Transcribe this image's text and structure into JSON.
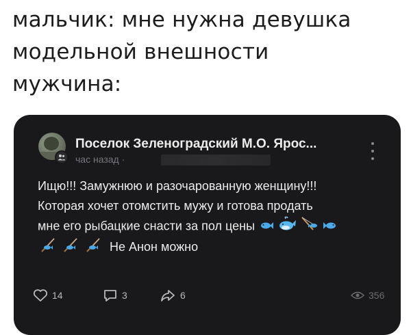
{
  "caption": {
    "lines": [
      "мальчик: мне нужна девушка",
      "модельной внешности",
      "мужчина:"
    ]
  },
  "post": {
    "channel_name": "Поселок Зеленоградский М.О. Ярос...",
    "time": "час назад ·",
    "text_lines": [
      "Ищю!!! Замужнюю и разочарованную женщину!!!",
      "Которая хочет отомстить мужу и готова продать",
      "мне его рыбацкие снасти за пол цены",
      "Не Анон можно"
    ],
    "emoji_line3": [
      "fish-icon",
      "whale-icon",
      "fishing-catch-icon",
      "fish-icon"
    ],
    "emoji_line4": [
      "fishing-pole-icon",
      "fishing-pole-icon",
      "fishing-pole-icon"
    ],
    "stats": {
      "likes": "14",
      "comments": "3",
      "shares": "6",
      "views": "356"
    }
  },
  "colors": {
    "card_background": "#19191b",
    "text_primary": "#ececec",
    "text_secondary": "#77777c",
    "page_background": "#ffffff"
  }
}
